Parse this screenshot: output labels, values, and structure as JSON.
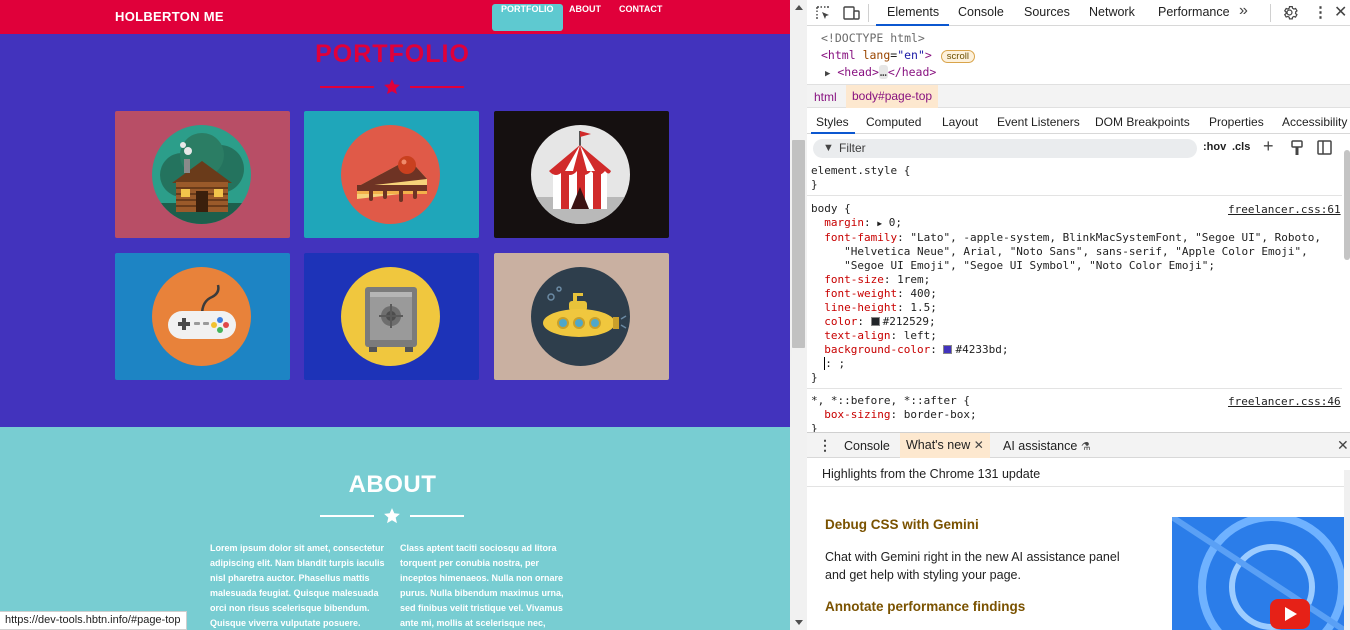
{
  "site": {
    "brand": "HOLBERTON ME",
    "nav": [
      {
        "label": "PORTFOLIO",
        "active": true
      },
      {
        "label": "ABOUT",
        "active": false
      },
      {
        "label": "CONTACT",
        "active": false
      }
    ],
    "portfolio_title": "PORTFOLIO",
    "portfolio_items": [
      {
        "name": "cabin",
        "bg": "#b84e66"
      },
      {
        "name": "cake",
        "bg": "#1fa6ba"
      },
      {
        "name": "circus",
        "bg": "#151010"
      },
      {
        "name": "game",
        "bg": "#1d84c4"
      },
      {
        "name": "safe",
        "bg": "#1d33b8"
      },
      {
        "name": "submarine",
        "bg": "#c9b0a1"
      }
    ],
    "about_title": "ABOUT",
    "about_left": "Lorem ipsum dolor sit amet, consectetur adipiscing elit. Nam blandit turpis iaculis nisl pharetra auctor. Phasellus mattis malesuada feugiat. Quisque malesuada orci non risus scelerisque bibendum. Quisque viverra vulputate posuere.",
    "about_right": "Class aptent taciti sociosqu ad litora torquent per conubia nostra, per inceptos himenaeos. Nulla non ornare purus. Nulla bibendum maximus urna, sed finibus velit tristique vel. Vivamus ante mi, mollis at scelerisque nec,",
    "status_url": "https://dev-tools.hbtn.info/#page-top",
    "colors": {
      "nav": "#e0003a",
      "body": "#4233bd",
      "about": "#78cdd2",
      "accent": "#5ec9d0"
    }
  },
  "devtools": {
    "tabs": [
      "Elements",
      "Console",
      "Sources",
      "Network",
      "Performance"
    ],
    "active_tab": "Elements",
    "dom": {
      "doctype": "<!DOCTYPE html>",
      "html_open": "<html",
      "html_attr": "lang",
      "html_val": "\"en\"",
      "html_close": ">",
      "scroll_badge": "scroll",
      "head": "<head>",
      "head_dots": "…",
      "head_close": "</head>"
    },
    "breadcrumbs": [
      "html",
      "body#page-top"
    ],
    "style_tabs": [
      "Styles",
      "Computed",
      "Layout",
      "Event Listeners",
      "DOM Breakpoints",
      "Properties",
      "Accessibility"
    ],
    "filter_placeholder": "Filter",
    "hov": ":hov",
    "cls": ".cls",
    "element_style": "element.style {",
    "element_style_close": "}",
    "body_rule": {
      "selector": "body {",
      "source": "freelancer.css:61",
      "margin_name": "margin",
      "margin_val": "0;",
      "font_family_name": "font-family",
      "font_family_l1": "\"Lato\", -apple-system, BlinkMacSystemFont, \"Segoe UI\", Roboto,",
      "font_family_l2": "\"Helvetica Neue\", Arial, \"Noto Sans\", sans-serif, \"Apple Color Emoji\",",
      "font_family_l3": "\"Segoe UI Emoji\", \"Segoe UI Symbol\", \"Noto Color Emoji\";",
      "font_size_name": "font-size",
      "font_size_val": "1rem;",
      "font_weight_name": "font-weight",
      "font_weight_val": "400;",
      "line_height_name": "line-height",
      "line_height_val": "1.5;",
      "color_name": "color",
      "color_val": "#212529;",
      "text_align_name": "text-align",
      "text_align_val": "left;",
      "bg_name": "background-color",
      "bg_val": "#4233bd;",
      "new_prop": ": ;",
      "close": "}"
    },
    "universal_rule": {
      "selector": "*, *::before, *::after {",
      "source": "freelancer.css:46",
      "prop_name": "box-sizing",
      "prop_val": "border-box;",
      "close": "}"
    },
    "drawer_tabs": [
      "Console",
      "What's new",
      "AI assistance"
    ],
    "drawer_selected": "What's new",
    "whats_new_heading": "Highlights from the Chrome 131 update",
    "items": [
      {
        "title": "Debug CSS with Gemini",
        "body": "Chat with Gemini right in the new AI assistance panel and get help with styling your page."
      },
      {
        "title": "Annotate performance findings",
        "body": ""
      }
    ]
  }
}
